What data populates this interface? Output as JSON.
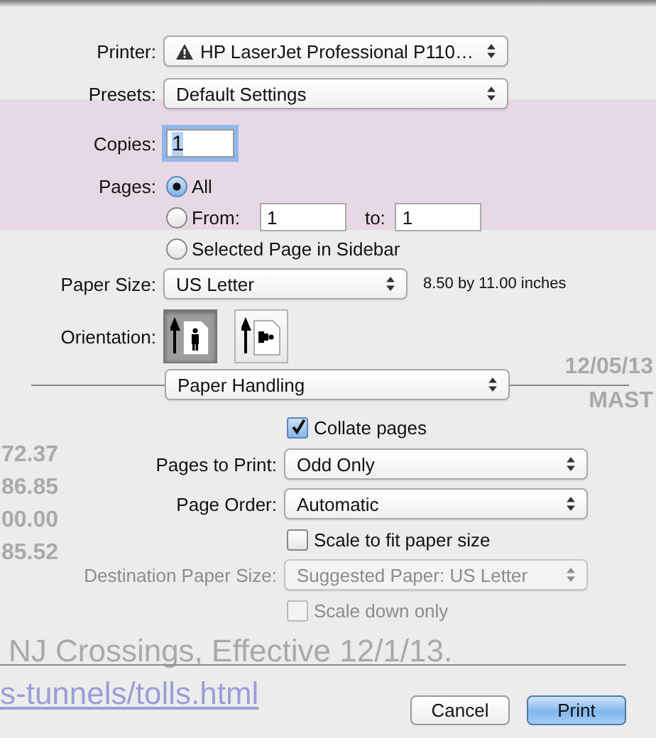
{
  "background_document": {
    "texts": [
      "72.37",
      "86.85",
      "00.00",
      "85.52",
      "12/05/13",
      "MAST",
      "NJ Crossings, Effective 12/1/13."
    ],
    "link": "s-tunnels/tolls.html"
  },
  "printer": {
    "label": "Printer:",
    "value": "HP LaserJet Professional P110…",
    "warning": true
  },
  "presets": {
    "label": "Presets:",
    "value": "Default Settings"
  },
  "copies": {
    "label": "Copies:",
    "value": "1",
    "text_selected": true
  },
  "pages": {
    "label": "Pages:",
    "options": [
      {
        "kind": "all",
        "label": "All",
        "selected": true
      },
      {
        "kind": "range",
        "label": "From:",
        "selected": false,
        "from": "1",
        "to_label": "to:",
        "to": "1"
      },
      {
        "kind": "plain",
        "label": "Selected Page in Sidebar",
        "selected": false
      }
    ]
  },
  "paper_size": {
    "label": "Paper Size:",
    "value": "US Letter",
    "dimensions": "8.50 by 11.00 inches"
  },
  "orientation": {
    "label": "Orientation:",
    "options": [
      {
        "kind": "portrait",
        "selected": true
      },
      {
        "kind": "landscape",
        "selected": false
      }
    ]
  },
  "section_menu": {
    "value": "Paper Handling"
  },
  "collate": {
    "label": "Collate pages",
    "checked": true
  },
  "pages_to_print": {
    "label": "Pages to Print:",
    "value": "Odd Only"
  },
  "page_order": {
    "label": "Page Order:",
    "value": "Automatic"
  },
  "scale_to_fit": {
    "label": "Scale to fit paper size",
    "checked": false
  },
  "destination_paper_size": {
    "label": "Destination Paper Size:",
    "value": "Suggested Paper: US Letter",
    "disabled": true
  },
  "scale_down_only": {
    "label": "Scale down only",
    "checked": false,
    "disabled": true
  },
  "buttons": [
    {
      "label": "Cancel",
      "kind": "normal"
    },
    {
      "label": "Print",
      "kind": "default"
    }
  ]
}
